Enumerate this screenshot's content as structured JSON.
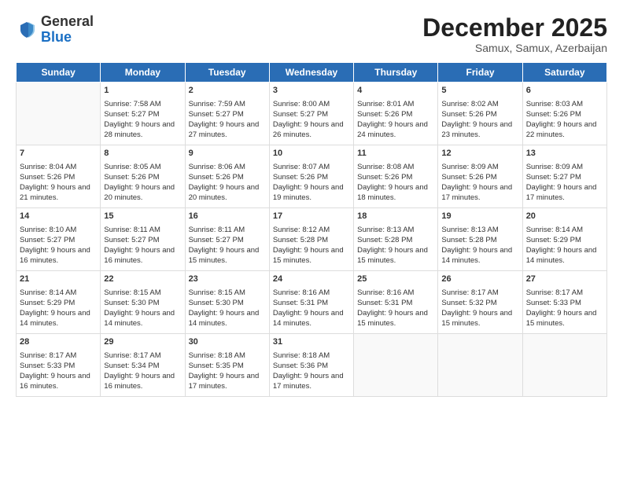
{
  "logo": {
    "general": "General",
    "blue": "Blue"
  },
  "title": "December 2025",
  "subtitle": "Samux, Samux, Azerbaijan",
  "headers": [
    "Sunday",
    "Monday",
    "Tuesday",
    "Wednesday",
    "Thursday",
    "Friday",
    "Saturday"
  ],
  "weeks": [
    [
      {
        "day": "",
        "sunrise": "",
        "sunset": "",
        "daylight": "",
        "empty": true
      },
      {
        "day": "1",
        "sunrise": "Sunrise: 7:58 AM",
        "sunset": "Sunset: 5:27 PM",
        "daylight": "Daylight: 9 hours and 28 minutes."
      },
      {
        "day": "2",
        "sunrise": "Sunrise: 7:59 AM",
        "sunset": "Sunset: 5:27 PM",
        "daylight": "Daylight: 9 hours and 27 minutes."
      },
      {
        "day": "3",
        "sunrise": "Sunrise: 8:00 AM",
        "sunset": "Sunset: 5:27 PM",
        "daylight": "Daylight: 9 hours and 26 minutes."
      },
      {
        "day": "4",
        "sunrise": "Sunrise: 8:01 AM",
        "sunset": "Sunset: 5:26 PM",
        "daylight": "Daylight: 9 hours and 24 minutes."
      },
      {
        "day": "5",
        "sunrise": "Sunrise: 8:02 AM",
        "sunset": "Sunset: 5:26 PM",
        "daylight": "Daylight: 9 hours and 23 minutes."
      },
      {
        "day": "6",
        "sunrise": "Sunrise: 8:03 AM",
        "sunset": "Sunset: 5:26 PM",
        "daylight": "Daylight: 9 hours and 22 minutes."
      }
    ],
    [
      {
        "day": "7",
        "sunrise": "Sunrise: 8:04 AM",
        "sunset": "Sunset: 5:26 PM",
        "daylight": "Daylight: 9 hours and 21 minutes."
      },
      {
        "day": "8",
        "sunrise": "Sunrise: 8:05 AM",
        "sunset": "Sunset: 5:26 PM",
        "daylight": "Daylight: 9 hours and 20 minutes."
      },
      {
        "day": "9",
        "sunrise": "Sunrise: 8:06 AM",
        "sunset": "Sunset: 5:26 PM",
        "daylight": "Daylight: 9 hours and 20 minutes."
      },
      {
        "day": "10",
        "sunrise": "Sunrise: 8:07 AM",
        "sunset": "Sunset: 5:26 PM",
        "daylight": "Daylight: 9 hours and 19 minutes."
      },
      {
        "day": "11",
        "sunrise": "Sunrise: 8:08 AM",
        "sunset": "Sunset: 5:26 PM",
        "daylight": "Daylight: 9 hours and 18 minutes."
      },
      {
        "day": "12",
        "sunrise": "Sunrise: 8:09 AM",
        "sunset": "Sunset: 5:26 PM",
        "daylight": "Daylight: 9 hours and 17 minutes."
      },
      {
        "day": "13",
        "sunrise": "Sunrise: 8:09 AM",
        "sunset": "Sunset: 5:27 PM",
        "daylight": "Daylight: 9 hours and 17 minutes."
      }
    ],
    [
      {
        "day": "14",
        "sunrise": "Sunrise: 8:10 AM",
        "sunset": "Sunset: 5:27 PM",
        "daylight": "Daylight: 9 hours and 16 minutes."
      },
      {
        "day": "15",
        "sunrise": "Sunrise: 8:11 AM",
        "sunset": "Sunset: 5:27 PM",
        "daylight": "Daylight: 9 hours and 16 minutes."
      },
      {
        "day": "16",
        "sunrise": "Sunrise: 8:11 AM",
        "sunset": "Sunset: 5:27 PM",
        "daylight": "Daylight: 9 hours and 15 minutes."
      },
      {
        "day": "17",
        "sunrise": "Sunrise: 8:12 AM",
        "sunset": "Sunset: 5:28 PM",
        "daylight": "Daylight: 9 hours and 15 minutes."
      },
      {
        "day": "18",
        "sunrise": "Sunrise: 8:13 AM",
        "sunset": "Sunset: 5:28 PM",
        "daylight": "Daylight: 9 hours and 15 minutes."
      },
      {
        "day": "19",
        "sunrise": "Sunrise: 8:13 AM",
        "sunset": "Sunset: 5:28 PM",
        "daylight": "Daylight: 9 hours and 14 minutes."
      },
      {
        "day": "20",
        "sunrise": "Sunrise: 8:14 AM",
        "sunset": "Sunset: 5:29 PM",
        "daylight": "Daylight: 9 hours and 14 minutes."
      }
    ],
    [
      {
        "day": "21",
        "sunrise": "Sunrise: 8:14 AM",
        "sunset": "Sunset: 5:29 PM",
        "daylight": "Daylight: 9 hours and 14 minutes."
      },
      {
        "day": "22",
        "sunrise": "Sunrise: 8:15 AM",
        "sunset": "Sunset: 5:30 PM",
        "daylight": "Daylight: 9 hours and 14 minutes."
      },
      {
        "day": "23",
        "sunrise": "Sunrise: 8:15 AM",
        "sunset": "Sunset: 5:30 PM",
        "daylight": "Daylight: 9 hours and 14 minutes."
      },
      {
        "day": "24",
        "sunrise": "Sunrise: 8:16 AM",
        "sunset": "Sunset: 5:31 PM",
        "daylight": "Daylight: 9 hours and 14 minutes."
      },
      {
        "day": "25",
        "sunrise": "Sunrise: 8:16 AM",
        "sunset": "Sunset: 5:31 PM",
        "daylight": "Daylight: 9 hours and 15 minutes."
      },
      {
        "day": "26",
        "sunrise": "Sunrise: 8:17 AM",
        "sunset": "Sunset: 5:32 PM",
        "daylight": "Daylight: 9 hours and 15 minutes."
      },
      {
        "day": "27",
        "sunrise": "Sunrise: 8:17 AM",
        "sunset": "Sunset: 5:33 PM",
        "daylight": "Daylight: 9 hours and 15 minutes."
      }
    ],
    [
      {
        "day": "28",
        "sunrise": "Sunrise: 8:17 AM",
        "sunset": "Sunset: 5:33 PM",
        "daylight": "Daylight: 9 hours and 16 minutes."
      },
      {
        "day": "29",
        "sunrise": "Sunrise: 8:17 AM",
        "sunset": "Sunset: 5:34 PM",
        "daylight": "Daylight: 9 hours and 16 minutes."
      },
      {
        "day": "30",
        "sunrise": "Sunrise: 8:18 AM",
        "sunset": "Sunset: 5:35 PM",
        "daylight": "Daylight: 9 hours and 17 minutes."
      },
      {
        "day": "31",
        "sunrise": "Sunrise: 8:18 AM",
        "sunset": "Sunset: 5:36 PM",
        "daylight": "Daylight: 9 hours and 17 minutes."
      },
      {
        "day": "",
        "sunrise": "",
        "sunset": "",
        "daylight": "",
        "empty": true
      },
      {
        "day": "",
        "sunrise": "",
        "sunset": "",
        "daylight": "",
        "empty": true
      },
      {
        "day": "",
        "sunrise": "",
        "sunset": "",
        "daylight": "",
        "empty": true
      }
    ]
  ]
}
